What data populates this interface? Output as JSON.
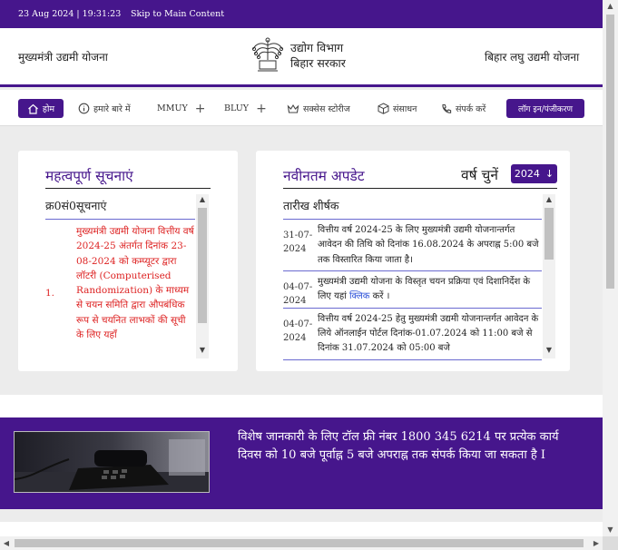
{
  "topbar": {
    "date_time": "23 Aug 2024 | 19:31:23",
    "skip_link": "Skip to Main Content"
  },
  "header": {
    "left_title": "मुख्यमंत्री उद्यमी योजना",
    "dept_line1": "उद्योग विभाग",
    "dept_line2": "बिहार सरकार",
    "right_title": "बिहार लघु उद्यमी योजना"
  },
  "nav": {
    "home": "होम",
    "about": "हमारे बारे में",
    "mmuy": "MMUY",
    "bluy": "BLUY",
    "success": "सक्सेस स्टोरीज",
    "resources": "संसाधन",
    "contact": "संपर्क करें",
    "login": "लॉग इन/पंजीकरण"
  },
  "notices": {
    "title": "महत्वपूर्ण सूचनाएं",
    "table_header": "क्र0सं0सूचनाएं",
    "rows": [
      {
        "num": "1.",
        "text": "मुख्यमंत्री उद्यमी योजना वित्तीय वर्ष 2024-25 अंतर्गत दिनांक 23-08-2024 को कम्प्यूटर द्वारा लॉटरी (Computerised Randomization) के माध्यम से चयन समिति द्वारा औपबंधिक रूप से चयनित लाभकों की सूची के लिए यहाँ"
      }
    ]
  },
  "updates": {
    "title": "नवीनतम अपडेट",
    "year_label": "वर्ष चुनें",
    "year_value": "2024",
    "table_header": "तारीख शीर्षक",
    "rows": [
      {
        "date": "31-07-2024",
        "text": "वित्तीय वर्ष 2024-25 के लिए मुख्यमंत्री उद्यमी योजनान्तर्गत आवेदन की तिथि को दिनांक 16.08.2024 के अपराह्न 5:00 बजे तक विस्तारित किया जाता है।"
      },
      {
        "date": "04-07-2024",
        "text_before": "मुख्यमंत्री उद्यमी योजना के विस्तृत चयन प्रक्रिया एवं दिशानिर्देश के लिए यहां ",
        "link": "क्लिक",
        "text_after": " करें ।"
      },
      {
        "date": "04-07-2024",
        "text": "वित्तीय वर्ष 2024-25 हेतु मुख्यमंत्री उद्यमी योजनान्तर्गत आवेदन के लिये ऑनलाईन पोर्टल दिनांक-01.07.2024 को 11:00 बजे से दिनांक 31.07.2024 को 05:00 बजे"
      }
    ]
  },
  "banner": {
    "text": "विशेष जानकारी के लिए टॉल फ्री नंबर 1800 345 6214 पर प्रत्येक कार्य दिवस को 10 बजे पूर्वाह्न 5 बजे अपराह्न तक संपर्क किया जा सकता है I"
  },
  "colors": {
    "brand_purple": "#46168c",
    "notice_red": "#dd2222",
    "link_blue": "#2a4fd8"
  },
  "icons": {
    "home": "home-icon",
    "about": "info-icon",
    "success": "crown-icon",
    "resources": "box-icon",
    "contact": "phone-icon",
    "year": "arrow-down-icon"
  }
}
